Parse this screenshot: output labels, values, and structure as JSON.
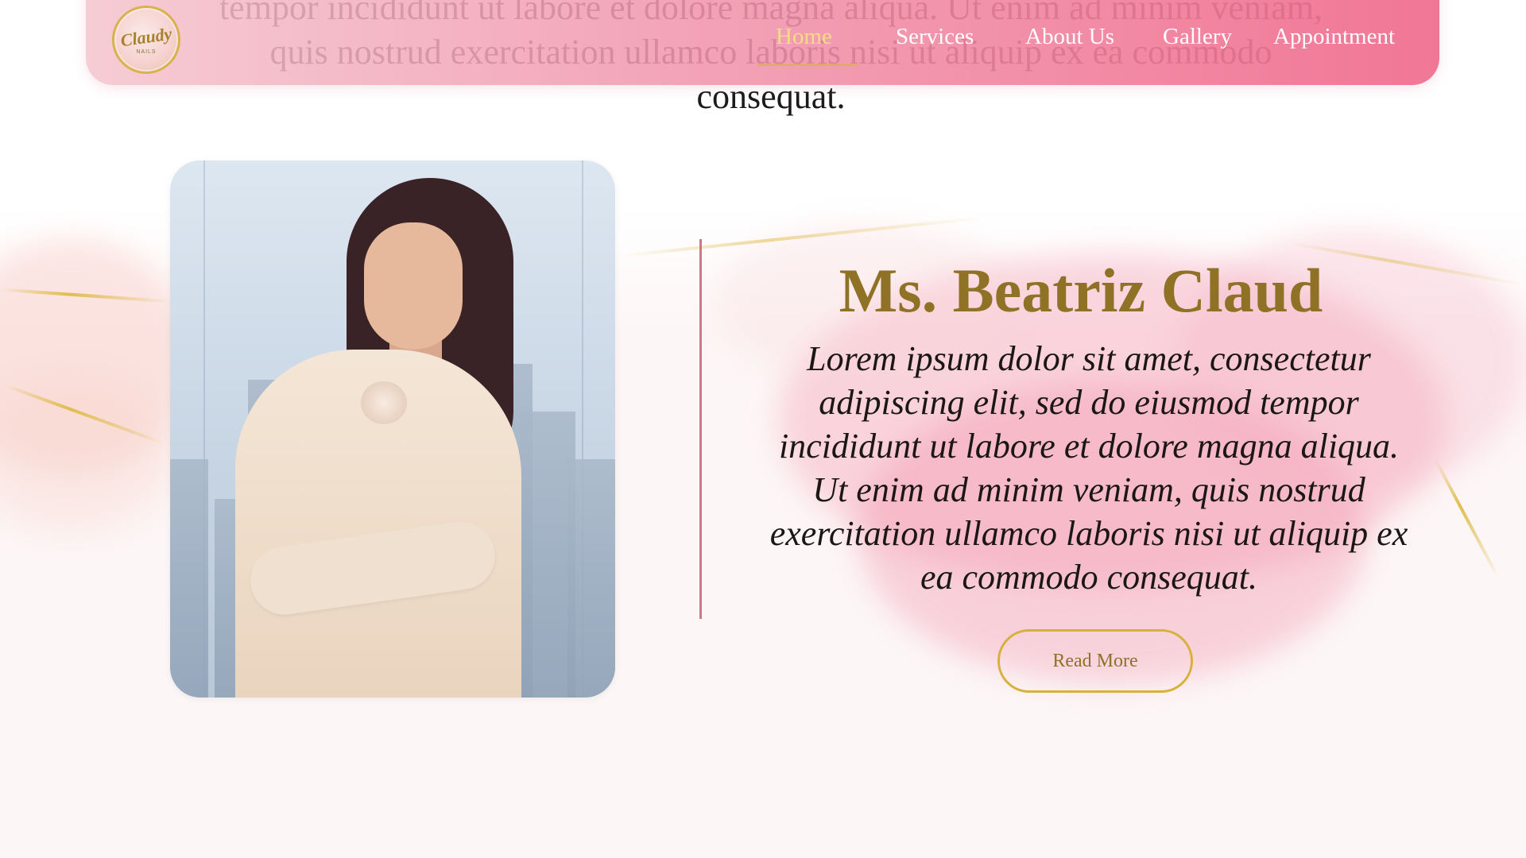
{
  "intro": {
    "text": "tempor incididunt ut labore et dolore magna aliqua. Ut enim ad minim veniam, quis nostrud exercitation ullamco laboris nisi ut aliquip ex ea commodo consequat."
  },
  "nav": {
    "logo_script": "Claudy",
    "logo_sub": "NAILS",
    "items": [
      {
        "label": "Home",
        "active": true
      },
      {
        "label": "Services"
      },
      {
        "label": "About Us"
      },
      {
        "label": "Gallery"
      },
      {
        "label": "Appointment"
      }
    ]
  },
  "bio": {
    "name": "Ms. Beatriz Claud",
    "text": "Lorem ipsum dolor sit amet, consectetur adipiscing elit, sed do eiusmod tempor incididunt ut labore et dolore magna aliqua. Ut enim ad minim veniam, quis nostrud exercitation ullamco laboris nisi ut aliquip ex ea commodo consequat.",
    "button_label": "Read More"
  },
  "colors": {
    "nav_gradient_start": "#f4c4ce",
    "nav_gradient_end": "#f06e8f",
    "gold_accent": "#d9b24d",
    "heading_gold": "#8f7226",
    "active_nav": "#f3dd84",
    "divider": "#c87a88"
  }
}
